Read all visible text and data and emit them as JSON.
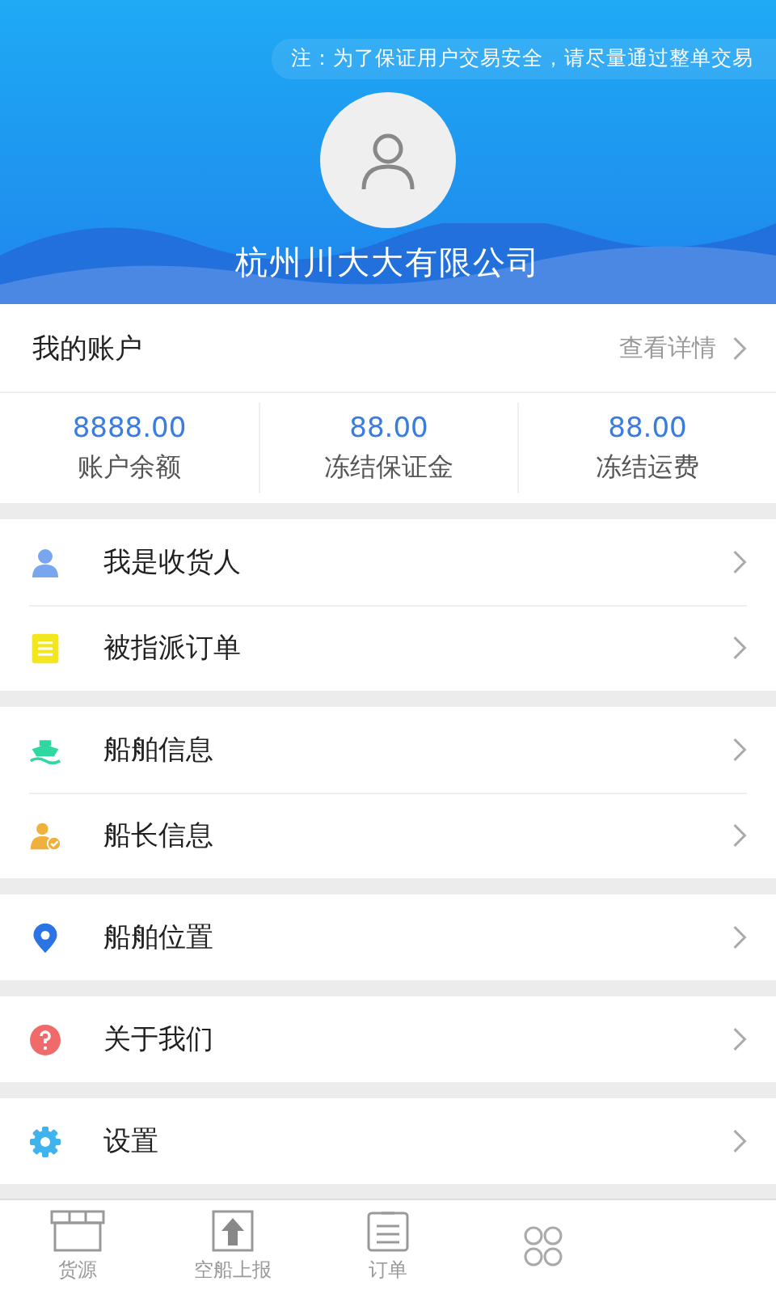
{
  "header": {
    "notice": "注：为了保证用户交易安全，请尽量通过整单交易",
    "company": "杭州川大大有限公司"
  },
  "account": {
    "title": "我的账户",
    "link": "查看详情",
    "stats": [
      {
        "value": "8888.00",
        "label": "账户余额"
      },
      {
        "value": "88.00",
        "label": "冻结保证金"
      },
      {
        "value": "88.00",
        "label": "冻结运费"
      }
    ]
  },
  "menu_groups": [
    {
      "items": [
        {
          "kind": "person",
          "label": "我是收货人"
        },
        {
          "kind": "document",
          "label": "被指派订单"
        }
      ]
    },
    {
      "items": [
        {
          "kind": "ship",
          "label": "船舶信息"
        },
        {
          "kind": "captain",
          "label": "船长信息"
        }
      ]
    },
    {
      "items": [
        {
          "kind": "pin",
          "label": "船舶位置"
        }
      ]
    },
    {
      "items": [
        {
          "kind": "help",
          "label": "关于我们"
        }
      ]
    },
    {
      "items": [
        {
          "kind": "gear",
          "label": "设置"
        }
      ]
    }
  ],
  "tabbar": [
    {
      "kind": "cargo",
      "label": "货源"
    },
    {
      "kind": "upload",
      "label": "空船上报"
    },
    {
      "kind": "orders",
      "label": "订单"
    },
    {
      "kind": "grid"
    }
  ]
}
